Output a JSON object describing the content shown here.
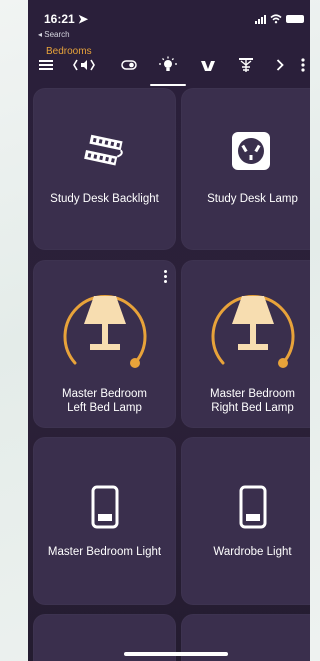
{
  "status_bar": {
    "time": "16:21",
    "back_label": "◂ Search"
  },
  "toolbar": {
    "room": "Bedrooms",
    "icons": [
      "menu-icon",
      "audio-icon",
      "toggle-icon",
      "light-bulb-icon",
      "scene-icon",
      "fan-icon",
      "next-icon"
    ],
    "more_label": ":"
  },
  "tiles": [
    {
      "label": "Study Desk Backlight",
      "icon": "led-strip-icon"
    },
    {
      "label": "Study Desk Lamp",
      "icon": "power-outlet-icon"
    },
    {
      "label_line1": "Master Bedroom",
      "label_line2": "Left Bed Lamp",
      "icon": "table-lamp-icon",
      "brightness": 0.75
    },
    {
      "label_line1": "Master Bedroom",
      "label_line2": "Right Bed Lamp",
      "icon": "table-lamp-icon",
      "brightness": 0.75
    },
    {
      "label": "Master Bedroom Light",
      "icon": "light-switch-icon"
    },
    {
      "label": "Wardrobe Light",
      "icon": "light-switch-icon"
    }
  ],
  "colors": {
    "accent": "#e8a33a",
    "tile_bg": "#3a2f4d",
    "lamp": "#f7ddb0"
  }
}
